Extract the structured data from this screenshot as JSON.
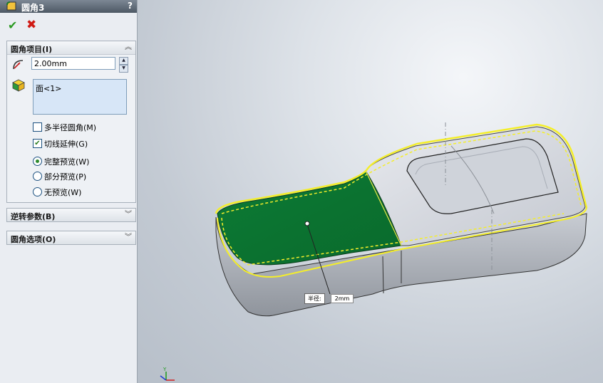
{
  "panel": {
    "title": "圆角3",
    "help_label": "?",
    "ok_icon": "check-icon",
    "cancel_icon": "x-icon"
  },
  "fillet_items": {
    "header": "圆角项目(I)",
    "radius_value": "2.00mm",
    "faces": [
      "面<1>"
    ],
    "options": [
      {
        "label": "多半径圆角(M)",
        "type": "checkbox",
        "checked": false
      },
      {
        "label": "切线延伸(G)",
        "type": "checkbox",
        "checked": true
      },
      {
        "label": "完整预览(W)",
        "type": "radio",
        "checked": true
      },
      {
        "label": "部分预览(P)",
        "type": "radio",
        "checked": false
      },
      {
        "label": "无预览(W)",
        "type": "radio",
        "checked": false
      }
    ]
  },
  "reverse_params": {
    "header": "逆转参数(B)"
  },
  "fillet_options": {
    "header": "圆角选项(O)"
  },
  "viewport": {
    "callout_label": "半径:",
    "callout_value": "2mm",
    "triad_label_y": "Y"
  },
  "colors": {
    "selected_face": "#0b7a34",
    "fillet_preview": "#f4ee2a",
    "part_body": "#b9bdc5"
  }
}
